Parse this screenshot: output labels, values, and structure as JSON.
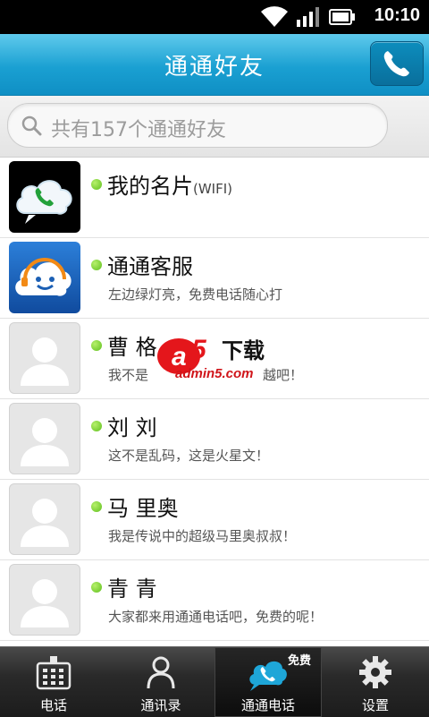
{
  "status_bar": {
    "time": "10:10"
  },
  "header": {
    "title": "通通好友"
  },
  "search": {
    "placeholder": "共有157个通通好友"
  },
  "contacts": [
    {
      "name": "我的名片",
      "suffix": "(WIFI)",
      "status": ""
    },
    {
      "name": "通通客服",
      "suffix": "",
      "status": "左边绿灯亮，免费电话随心打"
    },
    {
      "name": "曹 格",
      "suffix": "",
      "status": "我不是",
      "status_tail": "越吧！"
    },
    {
      "name": "刘 刘",
      "suffix": "",
      "status": "这不是乱码，这是火星文！"
    },
    {
      "name": "马 里奥",
      "suffix": "",
      "status": "我是传说中的超级马里奥叔叔！"
    },
    {
      "name": "青 青",
      "suffix": "",
      "status": "大家都来用通通电话吧，免费的呢！"
    }
  ],
  "watermark": {
    "brand": "下载",
    "site": "admin5.com",
    "logo_num": "5"
  },
  "bottom_nav": {
    "tabs": [
      {
        "label": "电话",
        "icon": "dialpad-icon"
      },
      {
        "label": "通讯录",
        "icon": "contacts-icon"
      },
      {
        "label": "通通电话",
        "icon": "tongtong-call-icon",
        "badge": "免费"
      },
      {
        "label": "设置",
        "icon": "gear-icon"
      }
    ]
  },
  "colors": {
    "header": "#1aa0d2",
    "online_dot": "#5fbf1d",
    "nav_bg": "#2a2a2a"
  }
}
